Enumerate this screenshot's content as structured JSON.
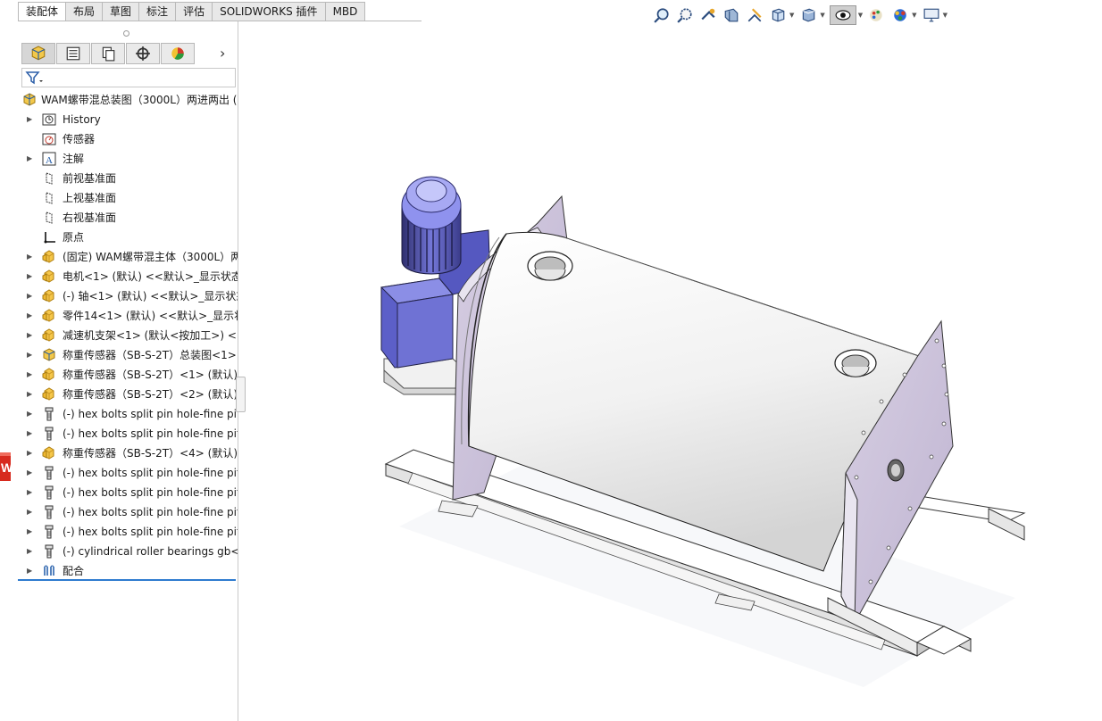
{
  "command_tabs": [
    "装配体",
    "布局",
    "草图",
    "标注",
    "评估",
    "SOLIDWORKS 插件",
    "MBD"
  ],
  "active_tab_index": 0,
  "panel_tabs": [
    {
      "icon": "featuremanager-icon"
    },
    {
      "icon": "propertymanager-icon"
    },
    {
      "icon": "configurationmanager-icon"
    },
    {
      "icon": "dimxpert-icon"
    },
    {
      "icon": "displaymanager-icon"
    }
  ],
  "panel_more": "›",
  "tree": {
    "root": "WAM螺带混总装图（3000L）两进两出 (",
    "items": [
      {
        "label": "History",
        "icon": "history-icon",
        "expand": true
      },
      {
        "label": "传感器",
        "icon": "sensor-icon",
        "expand": false
      },
      {
        "label": "注解",
        "icon": "annotation-icon",
        "expand": true
      },
      {
        "label": "前视基准面",
        "icon": "plane-icon",
        "expand": false
      },
      {
        "label": "上视基准面",
        "icon": "plane-icon",
        "expand": false
      },
      {
        "label": "右视基准面",
        "icon": "plane-icon",
        "expand": false
      },
      {
        "label": "原点",
        "icon": "origin-icon",
        "expand": false
      },
      {
        "label": "(固定) WAM螺带混主体（3000L）两",
        "icon": "part-icon",
        "expand": true
      },
      {
        "label": "电机<1> (默认) <<默认>_显示状态",
        "icon": "part-icon",
        "expand": true
      },
      {
        "label": "(-) 轴<1> (默认) <<默认>_显示状态",
        "icon": "part-icon",
        "expand": true
      },
      {
        "label": "零件14<1> (默认) <<默认>_显示状",
        "icon": "part-icon",
        "expand": true
      },
      {
        "label": "减速机支架<1> (默认<按加工>) <<",
        "icon": "part-icon",
        "expand": true
      },
      {
        "label": "称重传感器（SB-S-2T）总装图<1>",
        "icon": "assembly-icon",
        "expand": true
      },
      {
        "label": "称重传感器（SB-S-2T）<1> (默认)",
        "icon": "part-icon",
        "expand": true
      },
      {
        "label": "称重传感器（SB-S-2T）<2> (默认)",
        "icon": "part-icon",
        "expand": true
      },
      {
        "label": "(-) hex bolts split pin hole-fine pit",
        "icon": "bolt-icon",
        "expand": true
      },
      {
        "label": "(-) hex bolts split pin hole-fine pit",
        "icon": "bolt-icon",
        "expand": true
      },
      {
        "label": "称重传感器（SB-S-2T）<4> (默认)",
        "icon": "part-icon",
        "expand": true
      },
      {
        "label": "(-) hex bolts split pin hole-fine pit",
        "icon": "bolt-icon",
        "expand": true
      },
      {
        "label": "(-) hex bolts split pin hole-fine pit",
        "icon": "bolt-icon",
        "expand": true
      },
      {
        "label": "(-) hex bolts split pin hole-fine pit",
        "icon": "bolt-icon",
        "expand": true
      },
      {
        "label": "(-) hex bolts split pin hole-fine pit",
        "icon": "bolt-icon",
        "expand": true
      },
      {
        "label": "(-) cylindrical roller bearings gb<",
        "icon": "bolt-icon",
        "expand": true
      },
      {
        "label": "配合",
        "icon": "mates-icon",
        "expand": true
      }
    ]
  },
  "hud_tools": [
    {
      "icon": "zoom-to-fit-icon",
      "caret": false
    },
    {
      "icon": "zoom-to-area-icon",
      "caret": false
    },
    {
      "icon": "previous-view-icon",
      "caret": false
    },
    {
      "icon": "section-view-icon",
      "caret": false
    },
    {
      "icon": "dynamic-annotation-icon",
      "caret": false
    },
    {
      "icon": "view-orientation-icon",
      "caret": true
    },
    {
      "icon": "display-style-icon",
      "caret": true
    },
    {
      "icon": "hide-show-items-icon",
      "caret": true,
      "selected": true
    },
    {
      "icon": "edit-appearance-icon",
      "caret": false
    },
    {
      "icon": "apply-scene-icon",
      "caret": true
    },
    {
      "icon": "view-settings-icon",
      "caret": true
    }
  ],
  "colors": {
    "motor": "#6b6fd6",
    "body": "#f4f4f4",
    "plate": "#cfc6dc",
    "accent": "#2e7bcf",
    "logo": "#d72a1e"
  }
}
